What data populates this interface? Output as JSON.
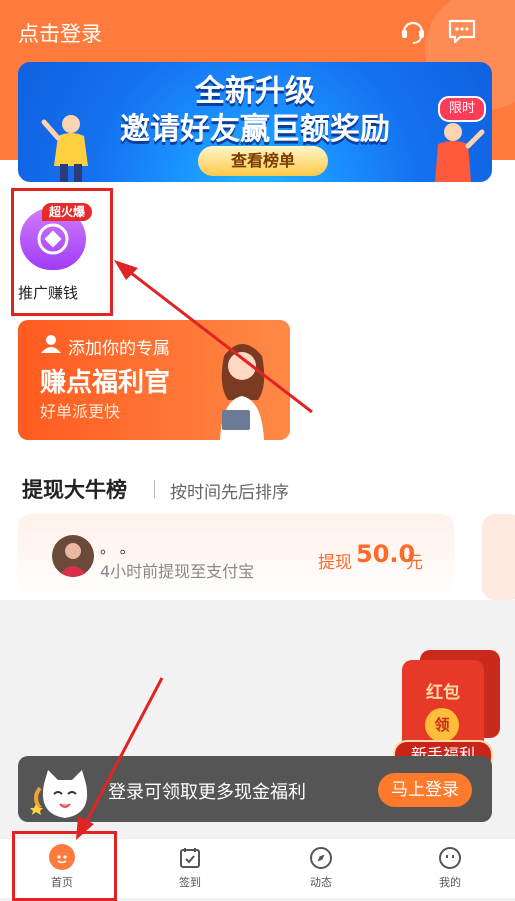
{
  "header": {
    "title": "点击登录",
    "icons": [
      "customer-service-icon",
      "message-icon"
    ]
  },
  "banner": {
    "title": "全新升级",
    "subtitle": "邀请好友赢巨额奖励",
    "button_label": "查看榜单",
    "tag": "限时"
  },
  "promo": {
    "badge": "超火爆",
    "label": "推广赚钱"
  },
  "officer_card": {
    "small_text": "添加你的专属",
    "big_text": "赚点福利官",
    "sub_text": "好单派更快"
  },
  "ranking": {
    "title": "提现大牛榜",
    "subtitle": "按时间先后排序",
    "items": [
      {
        "name": "。 。",
        "desc": "4小时前提现至支付宝",
        "amount_label": "提现",
        "amount": "50.0",
        "unit": "元"
      }
    ]
  },
  "red_envelope": {
    "title": "红包",
    "coin": "领",
    "label": "新手福利"
  },
  "login_bar": {
    "text": "登录可领取更多现金福利",
    "button_label": "马上登录"
  },
  "tabs": [
    {
      "label": "首页",
      "icon": "home-icon"
    },
    {
      "label": "签到",
      "icon": "checkin-icon"
    },
    {
      "label": "动态",
      "icon": "compass-icon"
    },
    {
      "label": "我的",
      "icon": "profile-icon"
    }
  ],
  "colors": {
    "primary": "#ff7b3d",
    "highlight": "#e02424",
    "banner": "#1a8cff"
  }
}
